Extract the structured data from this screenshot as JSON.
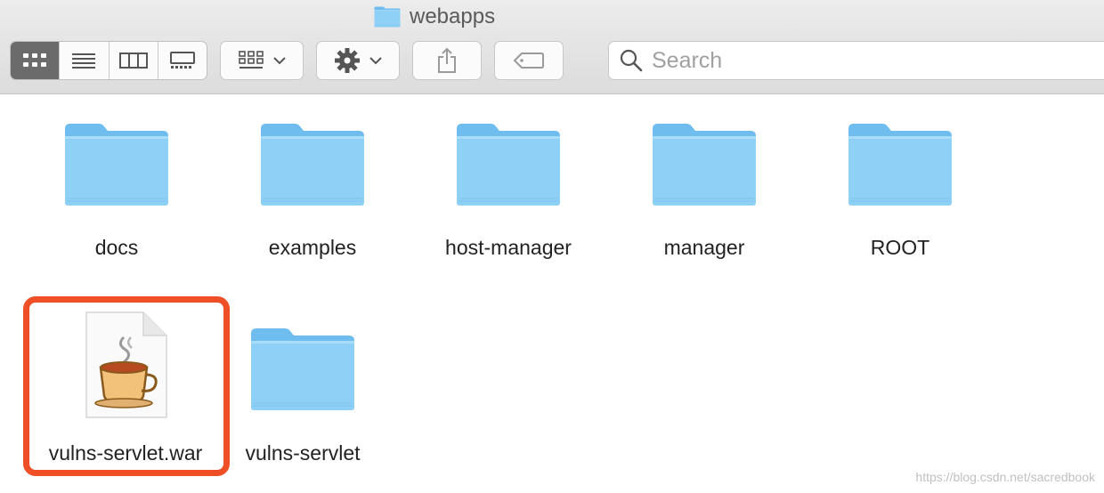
{
  "window": {
    "title": "webapps"
  },
  "toolbar": {
    "views": [
      "icon-view",
      "list-view",
      "column-view",
      "gallery-view"
    ],
    "arrange_icon": "grid-arrange-icon",
    "action_icon": "gear-icon",
    "share_icon": "share-icon",
    "tag_icon": "tag-icon"
  },
  "search": {
    "placeholder": "Search"
  },
  "files": [
    {
      "name": "docs",
      "type": "folder"
    },
    {
      "name": "examples",
      "type": "folder"
    },
    {
      "name": "host-manager",
      "type": "folder"
    },
    {
      "name": "manager",
      "type": "folder"
    },
    {
      "name": "ROOT",
      "type": "folder"
    },
    {
      "name": "vulns-servlet.war",
      "type": "java-archive",
      "highlighted": true
    },
    {
      "name": "vulns-servlet",
      "type": "folder"
    }
  ],
  "colors": {
    "highlight": "#ee4f27",
    "folder": "#8ccff5"
  },
  "watermark": "https://blog.csdn.net/sacredbook"
}
